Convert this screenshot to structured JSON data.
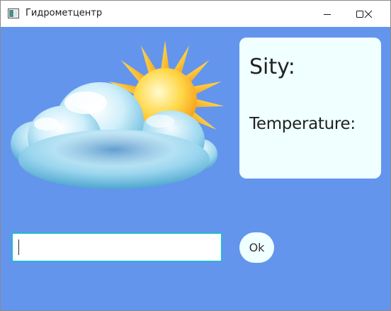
{
  "window": {
    "title": "Гидрометцентр",
    "app_icon": "window-app-icon",
    "controls": {
      "minimize_icon": "minimize-icon",
      "maximize_icon": "maximize-icon",
      "close_icon": "close-icon"
    }
  },
  "weather": {
    "image_icon": "sun-behind-cloud-icon"
  },
  "info": {
    "city_label": "Sity:",
    "temperature_label": "Temperature:"
  },
  "form": {
    "city_value": "",
    "ok_label": "Ok"
  },
  "colors": {
    "background": "#6495ED",
    "panel": "#F0FFFF",
    "input_border": "#21B8D4"
  }
}
